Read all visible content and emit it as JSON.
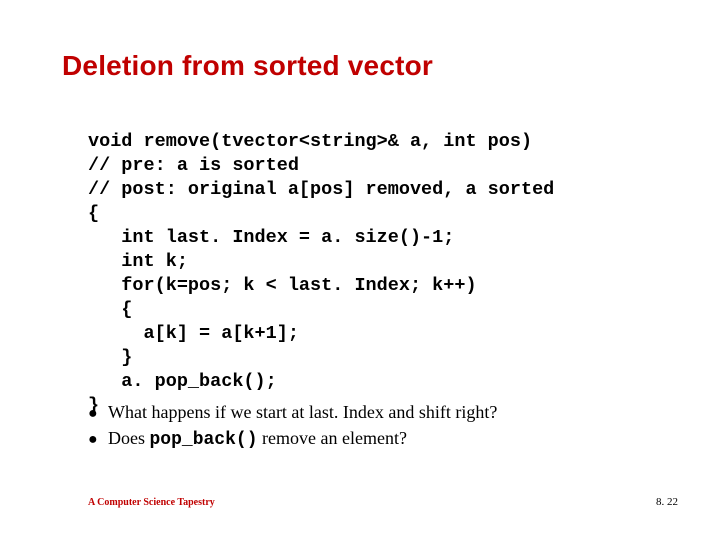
{
  "title": "Deletion from sorted vector",
  "code_lines": [
    "void remove(tvector<string>& a, int pos)",
    "// pre: a is sorted",
    "// post: original a[pos] removed, a sorted",
    "{",
    "   int last. Index = a. size()-1;",
    "   int k;",
    "   for(k=pos; k < last. Index; k++)",
    "   {",
    "     a[k] = a[k+1];",
    "   }",
    "   a. pop_back();",
    "}"
  ],
  "bullets": [
    {
      "prefix": "What happens if we start at last. Index and shift right?",
      "code": ""
    },
    {
      "prefix": "Does ",
      "code": "pop_back()",
      "suffix": " remove an element?"
    }
  ],
  "footer_left": "A Computer Science Tapestry",
  "footer_right": "8. 22",
  "chart_data": null
}
